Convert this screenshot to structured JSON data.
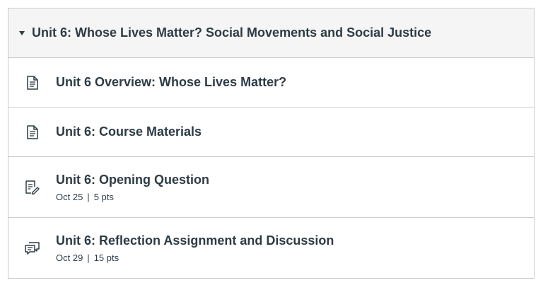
{
  "module": {
    "title": "Unit 6: Whose Lives Matter? Social Movements and Social Justice",
    "collapse_icon": "caret-down-icon"
  },
  "items": [
    {
      "icon": "page-icon",
      "title": "Unit 6 Overview: Whose Lives Matter?"
    },
    {
      "icon": "page-icon",
      "title": "Unit 6: Course Materials"
    },
    {
      "icon": "assignment-icon",
      "title": "Unit 6: Opening Question",
      "due": "Oct 25",
      "separator": "|",
      "points": "5 pts"
    },
    {
      "icon": "discussion-icon",
      "title": "Unit 6: Reflection Assignment and Discussion",
      "due": "Oct 29",
      "separator": "|",
      "points": "15 pts"
    }
  ],
  "colors": {
    "text": "#2d3b45",
    "border": "#c7cdd1",
    "header_bg": "#f5f5f5"
  }
}
